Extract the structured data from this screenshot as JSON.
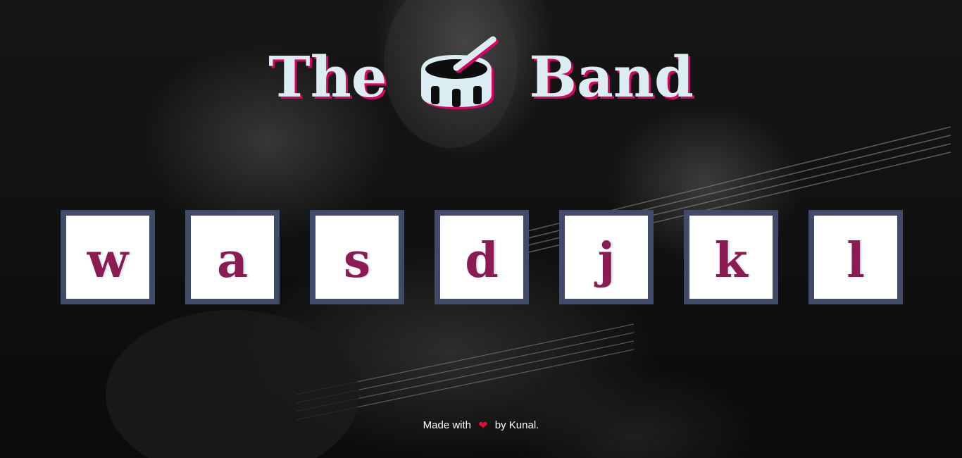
{
  "title": {
    "before_icon": "The",
    "icon": "drum-icon",
    "after_icon": "Band"
  },
  "keys": [
    {
      "label": "w"
    },
    {
      "label": "a"
    },
    {
      "label": "s"
    },
    {
      "label": "d"
    },
    {
      "label": "j"
    },
    {
      "label": "k"
    },
    {
      "label": "l"
    }
  ],
  "footer": {
    "prefix": "Made with",
    "heart_icon": "heart-icon",
    "suffix": "by Kunal."
  },
  "colors": {
    "title": "#dbedf3",
    "title_shadow": "#da0463",
    "key_border": "#404b69",
    "key_letter": "#8c1a53",
    "key_background": "#ffffff",
    "heart": "#e0102a"
  }
}
